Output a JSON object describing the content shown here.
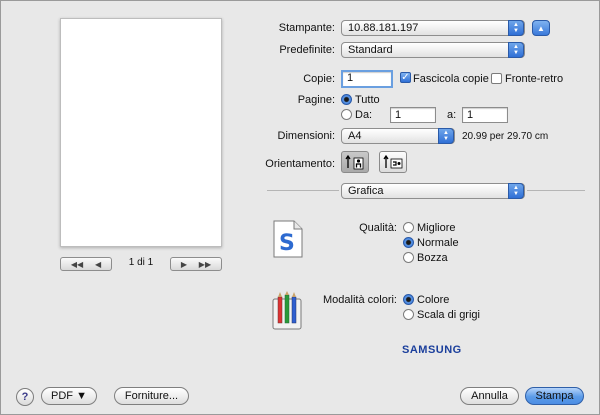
{
  "printer": {
    "label": "Stampante:",
    "value": "10.88.181.197"
  },
  "presets": {
    "label": "Predefinite:",
    "value": "Standard"
  },
  "copies": {
    "label": "Copie:",
    "value": "1",
    "collate_label": "Fascicola copie",
    "duplex_label": "Fronte-retro"
  },
  "pages": {
    "label": "Pagine:",
    "all_label": "Tutto",
    "from_label": "Da:",
    "from_value": "1",
    "to_label": "a:",
    "to_value": "1"
  },
  "paper_size": {
    "label": "Dimensioni:",
    "value": "A4",
    "dimensions": "20.99 per 29.70 cm"
  },
  "orientation": {
    "label": "Orientamento:"
  },
  "section": {
    "value": "Grafica"
  },
  "quality": {
    "label": "Qualità:",
    "options": [
      "Migliore",
      "Normale",
      "Bozza"
    ],
    "selected": "Normale"
  },
  "color_mode": {
    "label": "Modalità colori:",
    "options": [
      "Colore",
      "Scala di grigi"
    ],
    "selected": "Colore"
  },
  "brand": "SAMSUNG",
  "preview": {
    "page_indicator": "1 di 1"
  },
  "buttons": {
    "help": "?",
    "pdf": "PDF ▼",
    "supplies": "Forniture...",
    "cancel": "Annulla",
    "print": "Stampa"
  },
  "colors": {
    "accent": "#3a79da",
    "samsung": "#1b3f9c"
  }
}
